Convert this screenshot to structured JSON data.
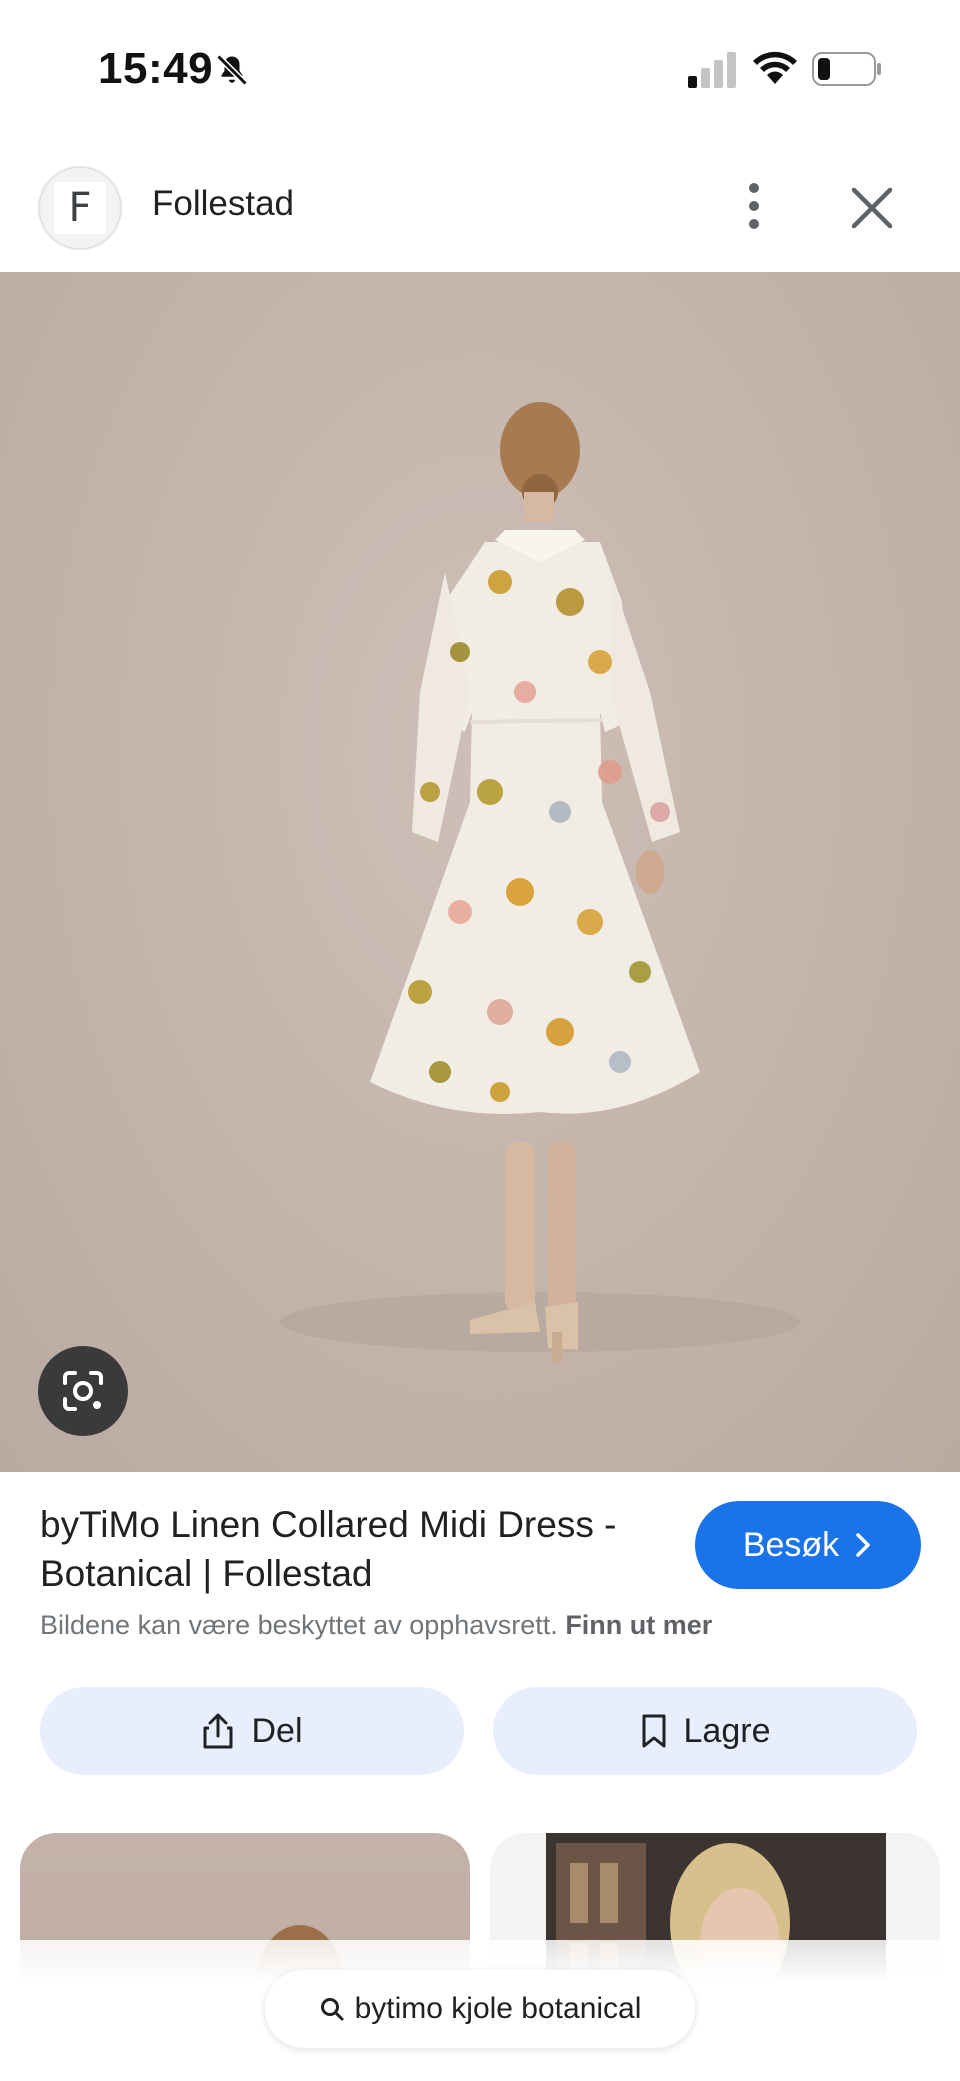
{
  "status_bar": {
    "time": "15:49",
    "icons": [
      "bell-off-icon",
      "cellular-signal-icon",
      "wifi-icon",
      "battery-icon"
    ]
  },
  "header": {
    "avatar_letter": "F",
    "site_name": "Follestad",
    "icons": [
      "more-vert-icon",
      "close-icon"
    ]
  },
  "image": {
    "lens_icon": "google-lens-icon"
  },
  "details": {
    "title": "byTiMo Linen Collared Midi Dress - Botanical | Follestad",
    "visit_label": "Besøk",
    "copyright_text": "Bildene kan være beskyttet av opphavsrett.",
    "learn_more": "Finn ut mer",
    "share_label": "Del",
    "save_label": "Lagre"
  },
  "search": {
    "query": "bytimo kjole botanical"
  },
  "colors": {
    "accent": "#1a73e8",
    "action_bg": "#e8eefc",
    "muted_text": "#70757a"
  }
}
